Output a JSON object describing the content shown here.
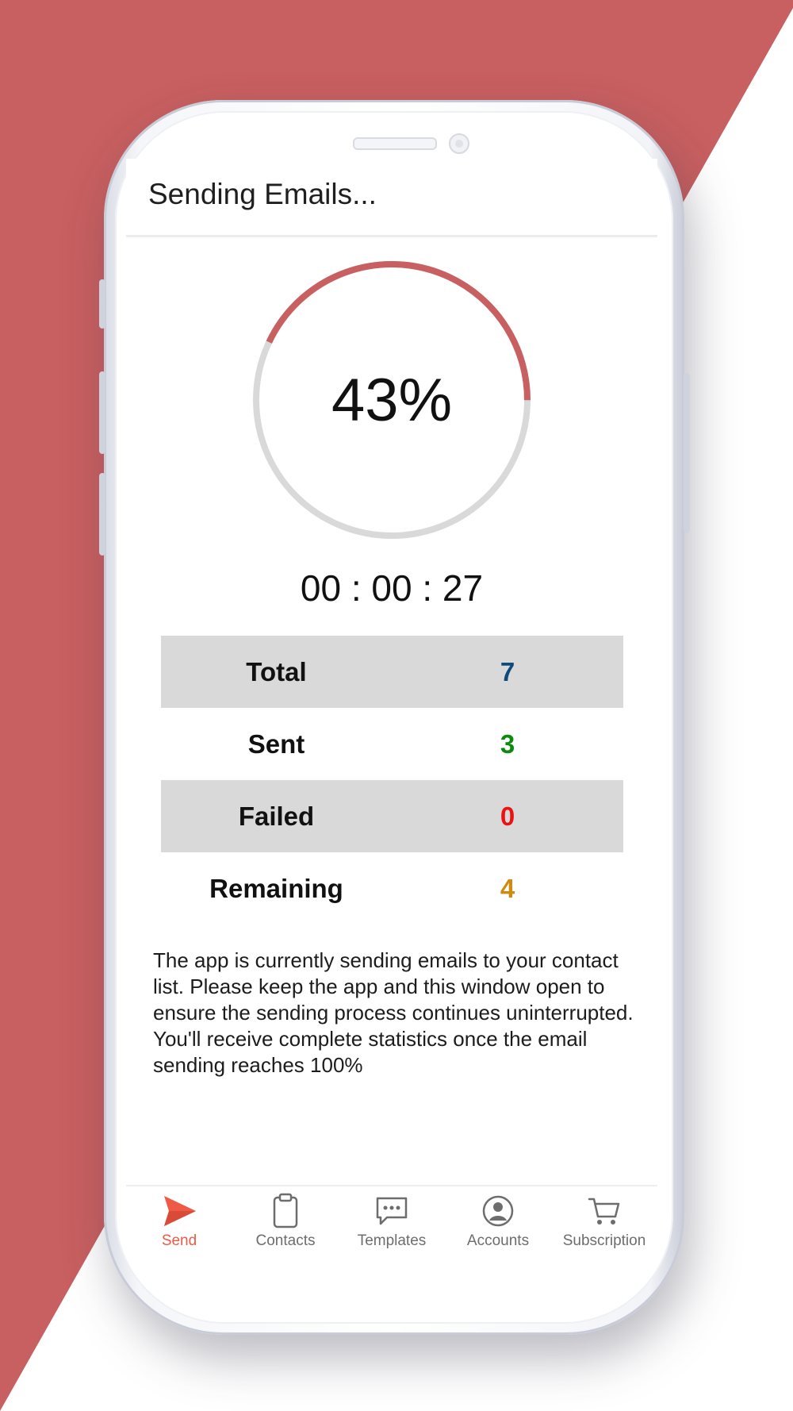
{
  "colors": {
    "brand": "#c85f60",
    "progress_track": "#d9d9d9",
    "active_nav": "#ee5a45",
    "total_value": "#0f4b7a",
    "sent_value": "#0d8a0d",
    "failed_value": "#ee1111",
    "remaining_value": "#cf8a10"
  },
  "app_bar": {
    "title": "Sending Emails..."
  },
  "progress": {
    "percent_label": "43%",
    "fraction": 0.43
  },
  "timer": {
    "elapsed": "00 : 00 : 27"
  },
  "stats": [
    {
      "label": "Total",
      "value": "7",
      "color_key": "total_value"
    },
    {
      "label": "Sent",
      "value": "3",
      "color_key": "sent_value"
    },
    {
      "label": "Failed",
      "value": "0",
      "color_key": "failed_value"
    },
    {
      "label": "Remaining",
      "value": "4",
      "color_key": "remaining_value"
    }
  ],
  "info_text": "The app is currently sending emails to your contact list. Please keep the app and this window open to ensure the sending process continues uninterrupted. You'll receive complete statistics once the email sending reaches 100%",
  "bottom_nav": [
    {
      "label": "Send",
      "icon": "send-icon",
      "active": true
    },
    {
      "label": "Contacts",
      "icon": "clipboard-icon",
      "active": false
    },
    {
      "label": "Templates",
      "icon": "chat-bubble-icon",
      "active": false
    },
    {
      "label": "Accounts",
      "icon": "account-circle-icon",
      "active": false
    },
    {
      "label": "Subscription",
      "icon": "cart-icon",
      "active": false
    }
  ]
}
